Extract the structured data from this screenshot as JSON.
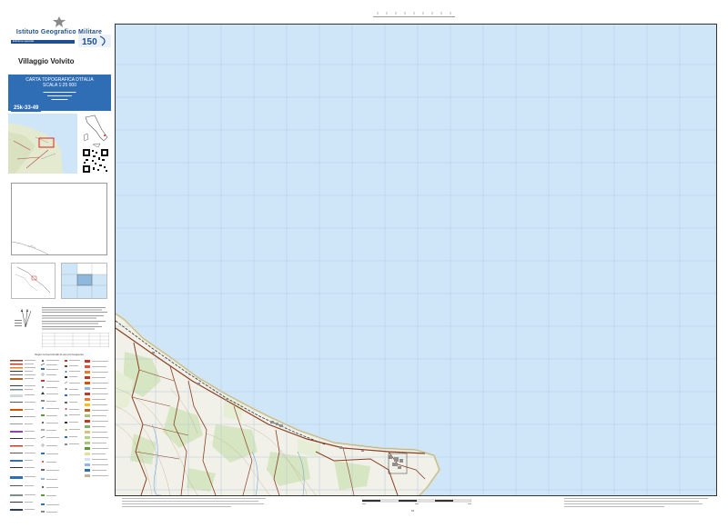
{
  "header": {
    "institute": "Istituto Geografico Militare",
    "edition_label": "Edizione speciale",
    "anniversary_badge": "150"
  },
  "sheet": {
    "locality": "Villaggio Volvito",
    "series_title": "CARTA TOPOGRAFICA D'ITALIA",
    "scale_text": "SCALA 1:25 000",
    "sheet_code": "25k-33-49"
  },
  "map": {
    "sea_color": "#cfe6f9",
    "land_color": "#f1f1ea",
    "road_color": "#8a3f20",
    "grid_color": "#b7c9db"
  },
  "legend": {
    "title": "Segni convenzionali di uso più frequente"
  },
  "footer": {
    "sheet_number": "61"
  },
  "icons": [
    "emblem-icon",
    "anniversary-logo-icon",
    "north-arrow-icon",
    "qr-code-icon"
  ]
}
